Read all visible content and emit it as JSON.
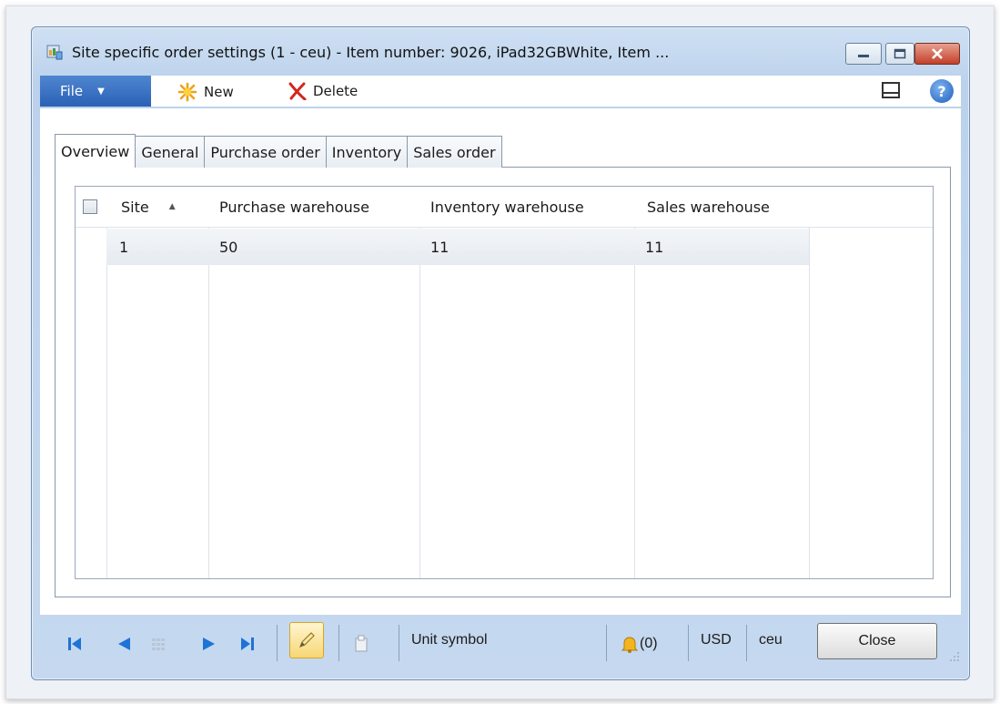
{
  "window": {
    "title": "Site specific order settings (1 - ceu) - Item number: 9026, iPad32GBWhite, Item ..."
  },
  "toolbar": {
    "file_label": "File",
    "new_label": "New",
    "delete_label": "Delete"
  },
  "tabs": [
    {
      "label": "Overview",
      "active": true
    },
    {
      "label": "General",
      "active": false
    },
    {
      "label": "Purchase order",
      "active": false
    },
    {
      "label": "Inventory",
      "active": false
    },
    {
      "label": "Sales order",
      "active": false
    }
  ],
  "grid": {
    "columns": [
      "Site",
      "Purchase warehouse",
      "Inventory warehouse",
      "Sales warehouse"
    ],
    "sort_indicator": "▲",
    "rows": [
      [
        "1",
        "50",
        "11",
        "11"
      ]
    ]
  },
  "statusbar": {
    "unit_label": "Unit symbol",
    "notifications": "(0)",
    "currency": "USD",
    "company": "ceu",
    "close_label": "Close"
  },
  "colors": {
    "accent": "#2b61b6",
    "window_frame": "#bcd2ec",
    "close_red": "#c2402a",
    "row_highlight": "#e6ebf1"
  }
}
